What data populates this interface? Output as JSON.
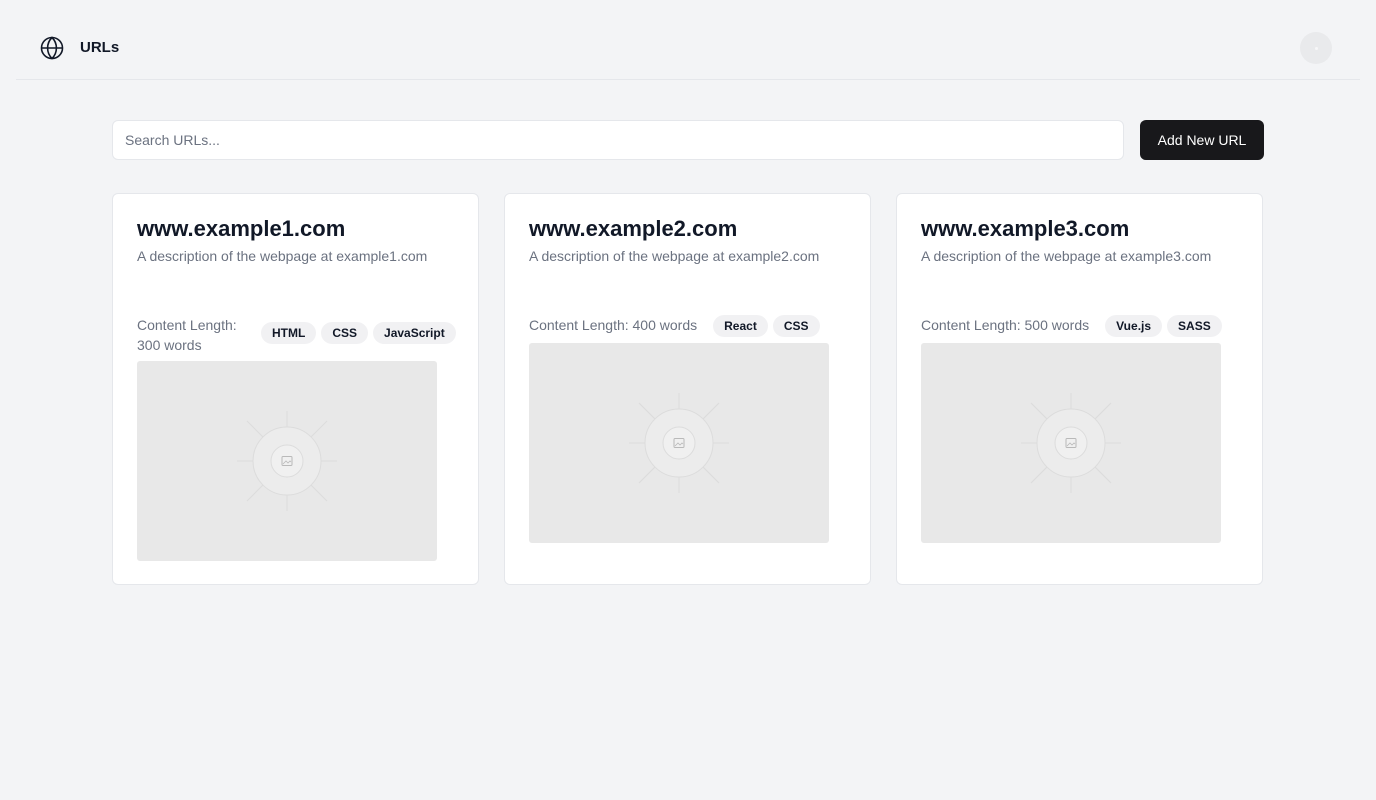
{
  "header": {
    "title": "URLs",
    "logo_icon": "globe-icon",
    "avatar_icon": "avatar"
  },
  "search": {
    "placeholder": "Search URLs...",
    "value": ""
  },
  "actions": {
    "add_label": "Add New URL"
  },
  "cards": [
    {
      "title": "www.example1.com",
      "description": "A description of the webpage at example1.com",
      "length_label": "Content Length: 300 words",
      "tags": [
        "HTML",
        "CSS",
        "JavaScript"
      ]
    },
    {
      "title": "www.example2.com",
      "description": "A description of the webpage at example2.com",
      "length_label": "Content Length: 400 words",
      "tags": [
        "React",
        "CSS"
      ]
    },
    {
      "title": "www.example3.com",
      "description": "A description of the webpage at example3.com",
      "length_label": "Content Length: 500 words",
      "tags": [
        "Vue.js",
        "SASS"
      ]
    }
  ],
  "colors": {
    "background": "#f3f4f6",
    "primary_button": "#18181b",
    "muted_text": "#6b7280",
    "tag_bg": "#f1f1f3",
    "thumbnail_bg": "#e8e8e8"
  }
}
